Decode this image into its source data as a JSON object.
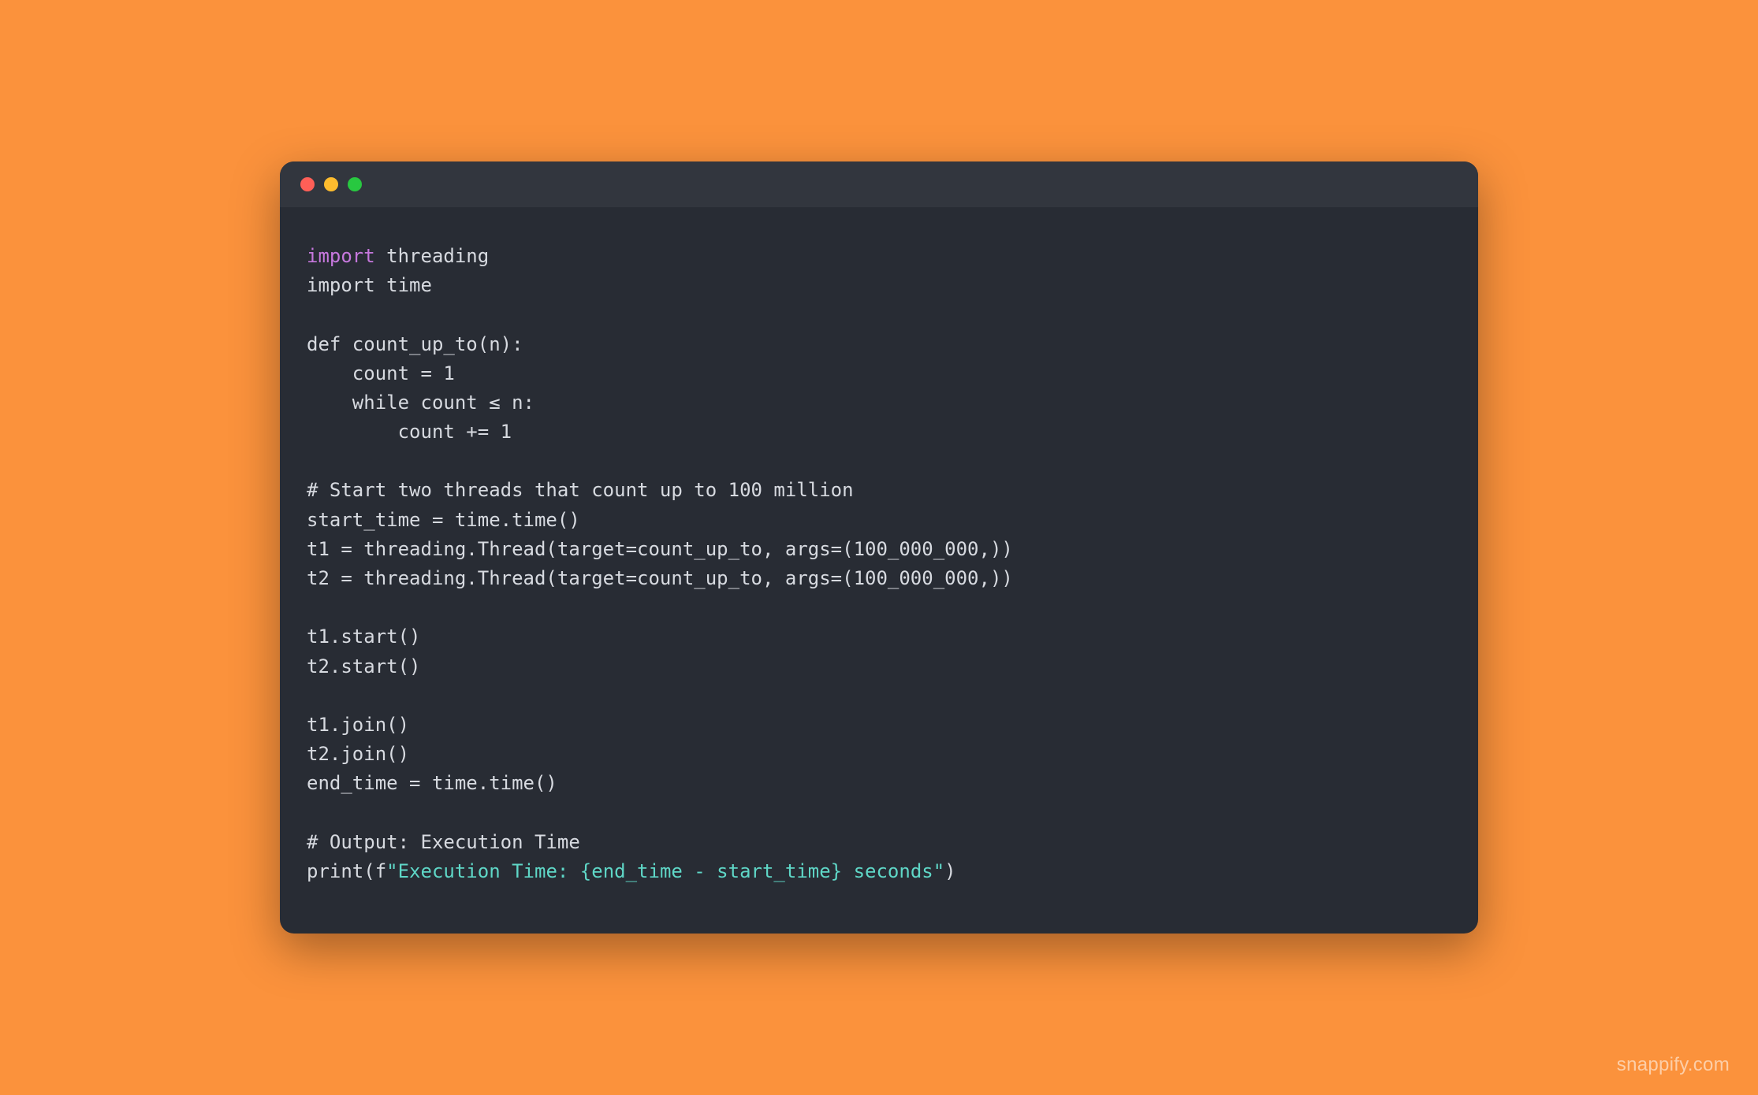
{
  "window": {
    "traffic_lights": [
      "red",
      "yellow",
      "green"
    ]
  },
  "code": {
    "tokens": [
      [
        {
          "t": "import",
          "c": "tok-keyword"
        },
        {
          "t": " threading",
          "c": "tok-import2"
        }
      ],
      [
        {
          "t": "import time",
          "c": "tok-def"
        }
      ],
      [
        {
          "t": "",
          "c": ""
        }
      ],
      [
        {
          "t": "def count_up_to(n):",
          "c": "tok-def"
        }
      ],
      [
        {
          "t": "    count = 1",
          "c": "tok-def"
        }
      ],
      [
        {
          "t": "    while count ≤ n:",
          "c": "tok-def"
        }
      ],
      [
        {
          "t": "        count += 1",
          "c": "tok-def"
        }
      ],
      [
        {
          "t": "",
          "c": ""
        }
      ],
      [
        {
          "t": "# Start two threads that count up to 100 million",
          "c": "tok-comment"
        }
      ],
      [
        {
          "t": "start_time = time.time()",
          "c": "tok-def"
        }
      ],
      [
        {
          "t": "t1 = threading.Thread(target=count_up_to, args=(100_000_000,))",
          "c": "tok-def"
        }
      ],
      [
        {
          "t": "t2 = threading.Thread(target=count_up_to, args=(100_000_000,))",
          "c": "tok-def"
        }
      ],
      [
        {
          "t": "",
          "c": ""
        }
      ],
      [
        {
          "t": "t1.start()",
          "c": "tok-def"
        }
      ],
      [
        {
          "t": "t2.start()",
          "c": "tok-def"
        }
      ],
      [
        {
          "t": "",
          "c": ""
        }
      ],
      [
        {
          "t": "t1.join()",
          "c": "tok-def"
        }
      ],
      [
        {
          "t": "t2.join()",
          "c": "tok-def"
        }
      ],
      [
        {
          "t": "end_time = time.time()",
          "c": "tok-def"
        }
      ],
      [
        {
          "t": "",
          "c": ""
        }
      ],
      [
        {
          "t": "# Output: Execution Time",
          "c": "tok-comment"
        }
      ],
      [
        {
          "t": "print(f",
          "c": "tok-def"
        },
        {
          "t": "\"Execution Time: {end_time - start_time} seconds\"",
          "c": "tok-string"
        },
        {
          "t": ")",
          "c": "tok-def"
        }
      ]
    ]
  },
  "watermark": "snappify.com"
}
